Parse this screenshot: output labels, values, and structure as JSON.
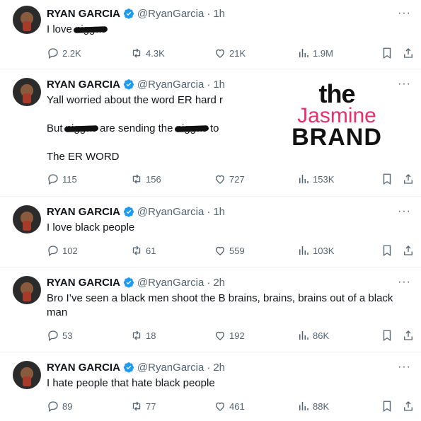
{
  "author": {
    "name": "RYAN GARCIA",
    "handle": "@RyanGarcia",
    "sep": "·",
    "more": "···"
  },
  "tweets": [
    {
      "time": "1h",
      "text_before": "I love ",
      "redacted": "niggas",
      "text_after": "",
      "replies": "2.2K",
      "reposts": "4.3K",
      "likes": "21K",
      "views": "1.9M"
    },
    {
      "time": "1h",
      "line1": "Yall worried about the word ER hard r",
      "line2_a": "But ",
      "line2_redact1": "niggas",
      "line2_b": " are sending the ",
      "line2_redact2": "niggas",
      "line2_c": " to",
      "line3": "The ER WORD",
      "replies": "115",
      "reposts": "156",
      "likes": "727",
      "views": "153K"
    },
    {
      "time": "1h",
      "text": "I love black people",
      "replies": "102",
      "reposts": "61",
      "likes": "559",
      "views": "103K"
    },
    {
      "time": "2h",
      "text": "Bro I’ve seen a black men shoot the B brains, brains, brains out of a black man",
      "replies": "53",
      "reposts": "18",
      "likes": "192",
      "views": "86K"
    },
    {
      "time": "2h",
      "text": "I hate people that hate black people",
      "replies": "89",
      "reposts": "77",
      "likes": "461",
      "views": "88K"
    }
  ],
  "watermark": {
    "line1": "the",
    "line2": "Jasmine",
    "line3": "BRAND"
  },
  "colors": {
    "verified": "#1d9bf0",
    "muted": "#536471",
    "brand_pink": "#e6306f"
  }
}
